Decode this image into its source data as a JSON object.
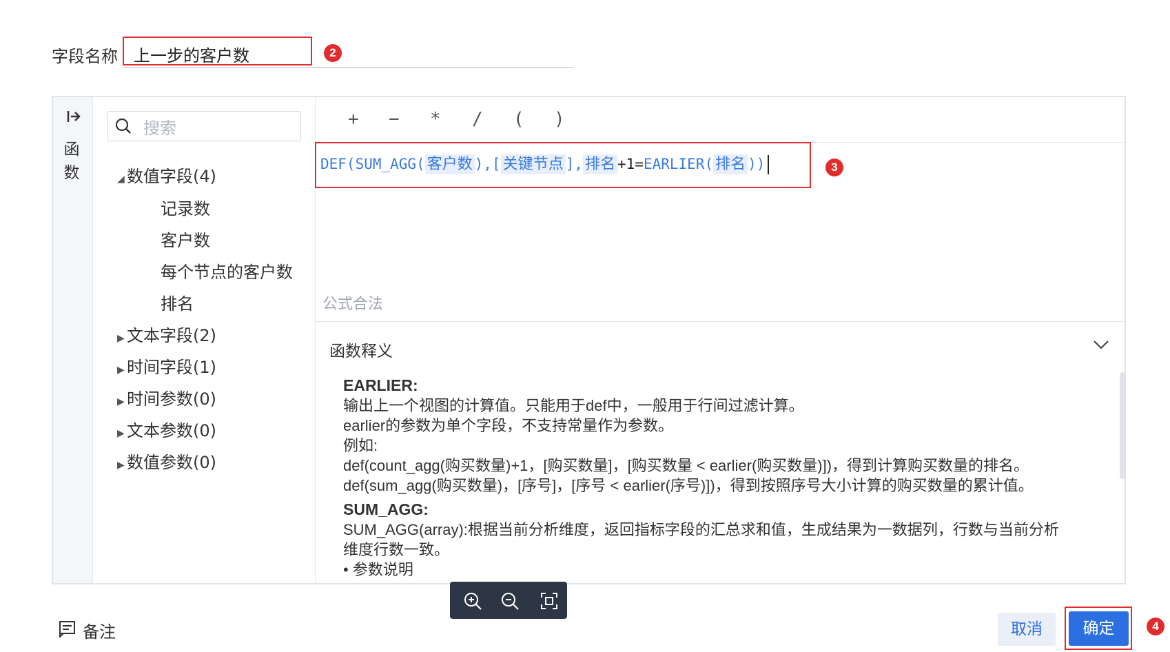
{
  "field": {
    "label": "字段名称",
    "value": "上一步的客户数"
  },
  "badges": [
    "2",
    "3",
    "4"
  ],
  "sidebar": {
    "label": "函数",
    "search_placeholder": "搜索"
  },
  "tree": {
    "numeric": {
      "label": "数值字段(4)",
      "expanded": true,
      "children": [
        "记录数",
        "客户数",
        "每个节点的客户数",
        "排名"
      ]
    },
    "collapsed": [
      "文本字段(2)",
      "时间字段(1)",
      "时间参数(0)",
      "文本参数(0)",
      "数值参数(0)"
    ]
  },
  "operators": [
    "+",
    "−",
    "*",
    "/",
    "(",
    ")"
  ],
  "formula": {
    "p1": "DEF(SUM_AGG(",
    "t1": "客户数",
    "p2": "),[",
    "t2": "关键节点",
    "p3": "],",
    "t3": "排名",
    "p4": "+1=",
    "p5": "EARLIER(",
    "t4": "排名",
    "p6": "))"
  },
  "validation": "公式合法",
  "description": {
    "title": "函数释义",
    "earlier_heading": "EARLIER:",
    "earlier_lines": [
      "输出上一个视图的计算值。只能用于def中，一般用于行间过滤计算。",
      "earlier的参数为单个字段，不支持常量作为参数。",
      "例如:",
      "def(count_agg(购买数量)+1，[购买数量]，[购买数量 < earlier(购买数量)])，得到计算购买数量的排名。",
      "def(sum_agg(购买数量)，[序号]，[序号 < earlier(序号)])，得到按照序号大小计算的购买数量的累计值。"
    ],
    "sum_heading": "SUM_AGG:",
    "sum_lines": [
      "SUM_AGG(array):根据当前分析维度，返回指标字段的汇总求和值，生成结果为一数据列，行数与当前分析",
      "维度行数一致。",
      "• 参数说明"
    ]
  },
  "footer": {
    "note_label": "备注",
    "cancel_label": "取消",
    "ok_label": "确定"
  },
  "colors": {
    "accent": "#2b6fe0",
    "annotation": "#e02c2c"
  }
}
